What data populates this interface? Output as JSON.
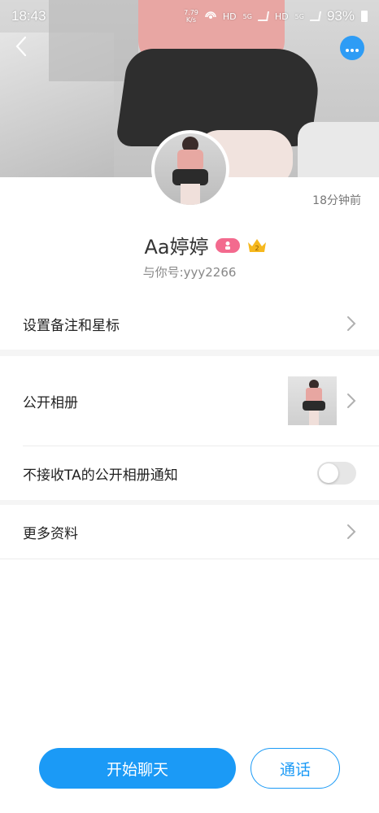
{
  "status_bar": {
    "time": "18:43",
    "net_speed_value": "7.79",
    "net_speed_unit": "K/s",
    "hd1": "HD",
    "net1": "5G",
    "hd2": "HD",
    "net2": "5G",
    "battery": "93%"
  },
  "profile": {
    "name": "Aa婷婷",
    "qq_label": "与你号:yyy2266",
    "last_seen": "18分钟前",
    "crown_level": "2"
  },
  "settings": {
    "remark_label": "设置备注和星标",
    "album_label": "公开相册",
    "album_notify_label": "不接收TA的公开相册通知",
    "album_notify_on": false,
    "more_info_label": "更多资料"
  },
  "actions": {
    "chat_label": "开始聊天",
    "call_label": "通话"
  },
  "colors": {
    "accent": "#1b9af6",
    "badge_pink": "#f36a8e",
    "crown": "#f6b81e"
  },
  "icons": {
    "back": "chevron-left-icon",
    "more": "more-dots-icon",
    "chevron": "chevron-right-icon",
    "crown": "crown-icon",
    "badge": "member-badge-icon"
  }
}
